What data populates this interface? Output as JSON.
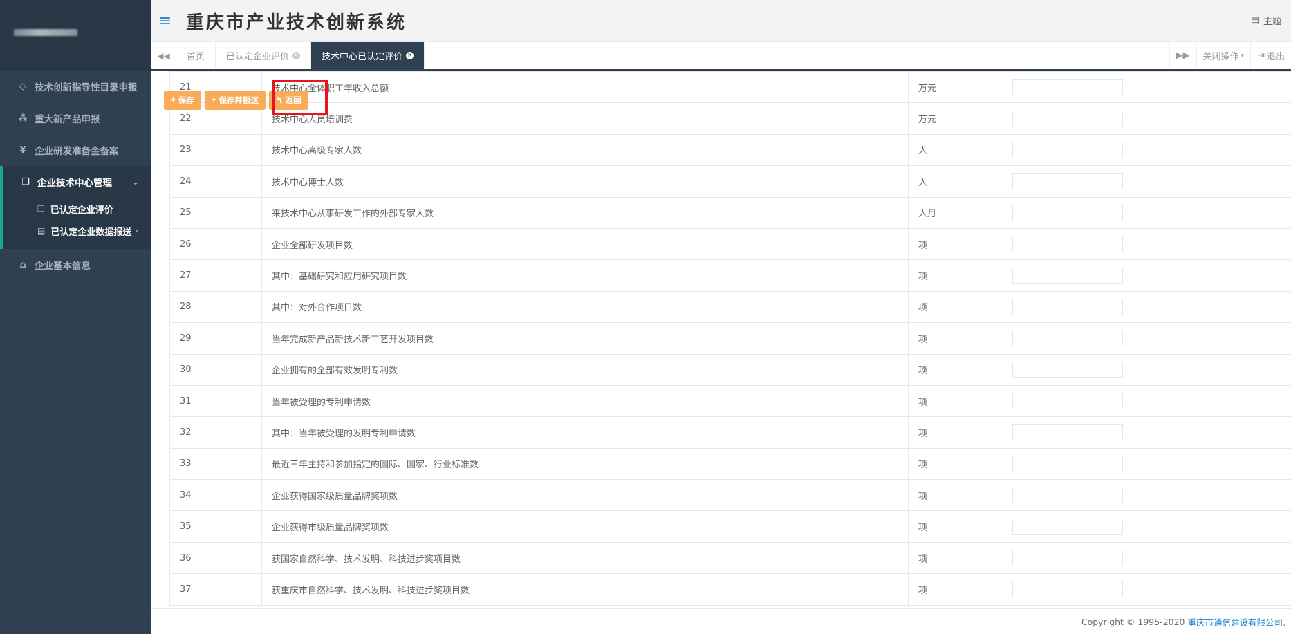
{
  "header": {
    "menu_icon": "hamburger-icon",
    "title": "重庆市产业技术创新系统",
    "theme_label": "主题"
  },
  "sidebar": {
    "items": [
      {
        "label": "技术创新指导性目录申报",
        "icon": "diamond-icon"
      },
      {
        "label": "重大新产品申报",
        "icon": "cubes-icon"
      },
      {
        "label": "企业研发准备金备案",
        "icon": "yen-icon"
      },
      {
        "label": "企业技术中心管理",
        "icon": "copy-icon"
      },
      {
        "label": "企业基本信息",
        "icon": "bank-icon"
      }
    ],
    "submenu": [
      {
        "label": "已认定企业评价",
        "icon": "files-icon"
      },
      {
        "label": "已认定企业数据报送",
        "icon": "file-text-icon"
      }
    ]
  },
  "tabs": {
    "items": [
      {
        "label": "首页"
      },
      {
        "label": "已认定企业评价"
      },
      {
        "label": "技术中心已认定评价"
      }
    ],
    "close_ops": "关闭操作",
    "logout": "退出"
  },
  "actions": {
    "save": "保存",
    "save_submit": "保存并报送",
    "back": "返回"
  },
  "table": {
    "rows": [
      {
        "no": "21",
        "name": "技术中心全体职工年收入总额",
        "unit": "万元",
        "value": ""
      },
      {
        "no": "22",
        "name": "技术中心人员培训费",
        "unit": "万元",
        "value": ""
      },
      {
        "no": "23",
        "name": "技术中心高级专家人数",
        "unit": "人",
        "value": ""
      },
      {
        "no": "24",
        "name": "技术中心博士人数",
        "unit": "人",
        "value": ""
      },
      {
        "no": "25",
        "name": "来技术中心从事研发工作的外部专家人数",
        "unit": "人月",
        "value": ""
      },
      {
        "no": "26",
        "name": "企业全部研发项目数",
        "unit": "项",
        "value": ""
      },
      {
        "no": "27",
        "name": "其中：基础研究和应用研究项目数",
        "unit": "项",
        "value": ""
      },
      {
        "no": "28",
        "name": "其中：对外合作项目数",
        "unit": "项",
        "value": ""
      },
      {
        "no": "29",
        "name": "当年完成新产品新技术新工艺开发项目数",
        "unit": "项",
        "value": ""
      },
      {
        "no": "30",
        "name": "企业拥有的全部有效发明专利数",
        "unit": "项",
        "value": ""
      },
      {
        "no": "31",
        "name": "当年被受理的专利申请数",
        "unit": "项",
        "value": ""
      },
      {
        "no": "32",
        "name": "其中：当年被受理的发明专利申请数",
        "unit": "项",
        "value": ""
      },
      {
        "no": "33",
        "name": "最近三年主持和参加指定的国际、国家、行业标准数",
        "unit": "项",
        "value": ""
      },
      {
        "no": "34",
        "name": "企业获得国家级质量品牌奖项数",
        "unit": "项",
        "value": ""
      },
      {
        "no": "35",
        "name": "企业获得市级质量品牌奖项数",
        "unit": "项",
        "value": ""
      },
      {
        "no": "36",
        "name": "获国家自然科学、技术发明、科技进步奖项目数",
        "unit": "项",
        "value": ""
      },
      {
        "no": "37",
        "name": "获重庆市自然科学、技术发明、科技进步奖项目数",
        "unit": "项",
        "value": ""
      }
    ]
  },
  "footer": {
    "copyright": "Copyright © 1995-2020",
    "company": "重庆市通信建设有限公司."
  },
  "colors": {
    "sidebar_bg": "#2f4050",
    "accent_green": "#19aa8d",
    "button_orange": "#f8ac59",
    "highlight_red": "#e8141e",
    "link_blue": "#1c84c6"
  }
}
